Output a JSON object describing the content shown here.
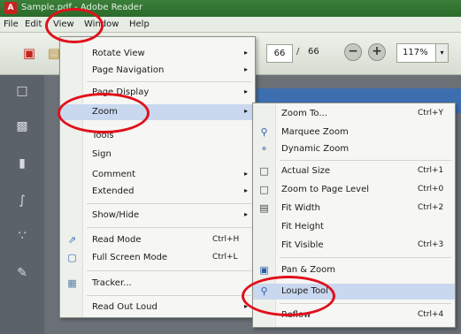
{
  "window": {
    "title": "Sample.pdf - Adobe Reader",
    "app_icon": "pdf-app-icon"
  },
  "menubar": {
    "items": [
      "File",
      "Edit",
      "View",
      "Window",
      "Help"
    ]
  },
  "toolbar": {
    "current_page": "66",
    "page_separator": "/",
    "total_pages": "66",
    "zoom_value": "117%",
    "zoom_out_glyph": "−",
    "zoom_in_glyph": "+",
    "dropdown_glyph": "▾"
  },
  "view_menu": {
    "items": [
      {
        "label": "Rotate View",
        "arrow": "▸",
        "icon": ""
      },
      {
        "label": "Page Navigation",
        "arrow": "▸",
        "icon": ""
      },
      {
        "label": "Page Display",
        "arrow": "▸",
        "icon": ""
      },
      {
        "label": "Zoom",
        "arrow": "▸",
        "icon": ""
      },
      {
        "label": "Tools",
        "arrow": "",
        "icon": ""
      },
      {
        "label": "Sign",
        "arrow": "",
        "icon": ""
      },
      {
        "label": "Comment",
        "arrow": "▸",
        "icon": ""
      },
      {
        "label": "Extended",
        "arrow": "▸",
        "icon": ""
      },
      {
        "label": "Show/Hide",
        "arrow": "▸",
        "icon": ""
      },
      {
        "label": "Read Mode",
        "shortcut": "Ctrl+H",
        "icon": "read-mode-icon"
      },
      {
        "label": "Full Screen Mode",
        "shortcut": "Ctrl+L",
        "icon": "full-screen-icon"
      },
      {
        "label": "Tracker...",
        "arrow": "",
        "icon": "tracker-icon"
      },
      {
        "label": "Read Out Loud",
        "arrow": "▸",
        "icon": ""
      }
    ]
  },
  "zoom_menu": {
    "items": [
      {
        "label": "Zoom To...",
        "shortcut": "Ctrl+Y",
        "icon": ""
      },
      {
        "label": "Marquee Zoom",
        "shortcut": "",
        "icon": "marquee-zoom-icon"
      },
      {
        "label": "Dynamic Zoom",
        "shortcut": "",
        "icon": "dynamic-zoom-icon"
      },
      {
        "label": "Actual Size",
        "shortcut": "Ctrl+1",
        "icon": "actual-size-icon"
      },
      {
        "label": "Zoom to Page Level",
        "shortcut": "Ctrl+0",
        "icon": "page-level-icon"
      },
      {
        "label": "Fit Width",
        "shortcut": "Ctrl+2",
        "icon": "fit-width-icon"
      },
      {
        "label": "Fit Height",
        "shortcut": "",
        "icon": ""
      },
      {
        "label": "Fit Visible",
        "shortcut": "Ctrl+3",
        "icon": ""
      },
      {
        "label": "Pan & Zoom",
        "shortcut": "",
        "icon": "pan-zoom-icon"
      },
      {
        "label": "Loupe Tool",
        "shortcut": "",
        "icon": "loupe-tool-icon"
      },
      {
        "label": "Reflow",
        "shortcut": "Ctrl+4",
        "icon": ""
      }
    ]
  },
  "colors": {
    "annotation": "#e0101a",
    "highlight": "#c9d8ee",
    "title_bar": "#2b6a2b"
  }
}
